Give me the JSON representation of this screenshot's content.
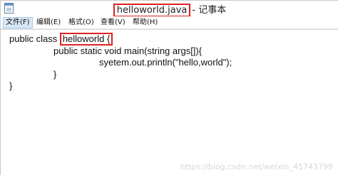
{
  "window": {
    "title_file": "helloworld.java",
    "title_sep": "- 记事本"
  },
  "menu": {
    "items": [
      "文件(F)",
      "编辑(E)",
      "格式(O)",
      "查看(V)",
      "帮助(H)"
    ]
  },
  "editor": {
    "line1_pre": "public class ",
    "line1_highlight": "helloworld {",
    "line2": "public static void main(string args[]){",
    "line3": "syetem.out.println(\"hello,world\");",
    "line4": "}",
    "line5": "}"
  },
  "watermark": "https://blog.csdn.net/weixin_45743799",
  "colors": {
    "highlight_border": "#e02020",
    "active_menu_bg": "#d9e8f7"
  }
}
